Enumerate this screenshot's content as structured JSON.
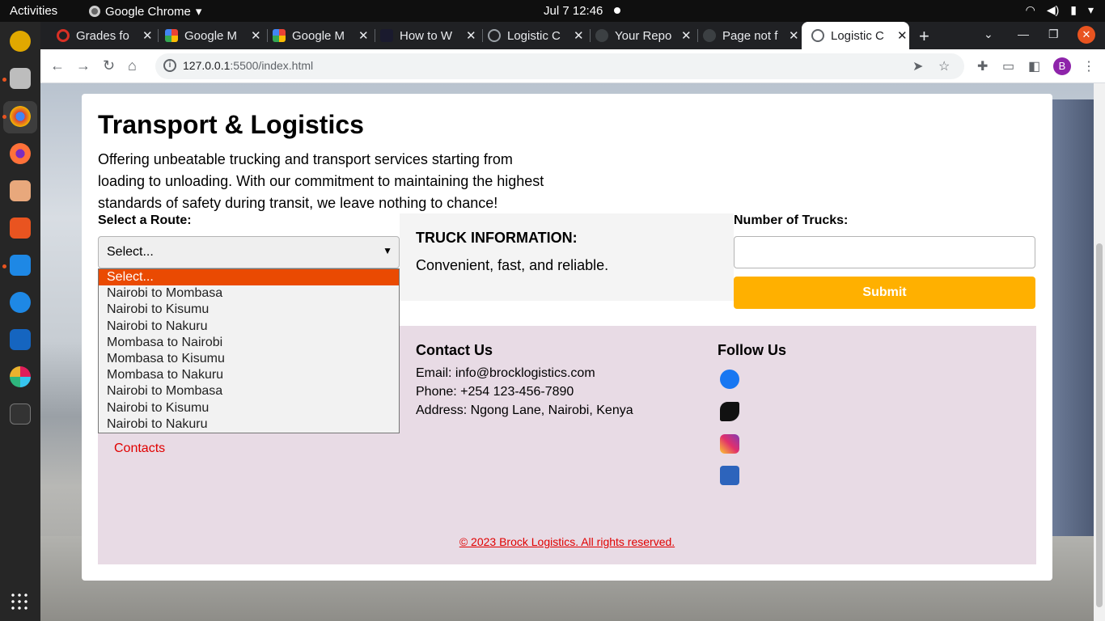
{
  "system": {
    "activities": "Activities",
    "app_name": "Google Chrome",
    "clock": "Jul 7  12:46"
  },
  "browser": {
    "tabs": [
      {
        "title": "Grades fo"
      },
      {
        "title": "Google M"
      },
      {
        "title": "Google M"
      },
      {
        "title": "How to W"
      },
      {
        "title": "Logistic C"
      },
      {
        "title": "Your Repo"
      },
      {
        "title": "Page not f"
      },
      {
        "title": "Logistic C"
      }
    ],
    "url_host": "127.0.0.1",
    "url_path": ":5500/index.html",
    "profile_initial": "B"
  },
  "page": {
    "title": "Transport & Logistics",
    "intro": "Offering unbeatable trucking and transport services starting from loading to unloading. With our commitment to maintaining the highest standards of safety during transit, we leave nothing to chance!",
    "route_label": "Select a Route:",
    "route_selected": "Select...",
    "route_options": [
      "Select...",
      "Nairobi to Mombasa",
      "Nairobi to Kisumu",
      "Nairobi to Nakuru",
      "Mombasa to Nairobi",
      "Mombasa to Kisumu",
      "Mombasa to Nakuru",
      "Nairobi to Mombasa",
      "Nairobi to Kisumu",
      "Nairobi to Nakuru"
    ],
    "truck_info_heading": "TRUCK INFORMATION:",
    "truck_info_text": "Convenient, fast, and reliable.",
    "trucks_label": "Number of Trucks:",
    "trucks_value": "",
    "submit_label": "Submit"
  },
  "footer": {
    "contacts_link": "Contacts",
    "contact_heading": "Contact Us",
    "email": "Email: info@brocklogistics.com",
    "phone": "Phone: +254 123-456-7890",
    "address": "Address: Ngong Lane, Nairobi, Kenya",
    "follow_heading": "Follow Us",
    "social": [
      "facebook-icon",
      "twitter-icon",
      "instagram-icon",
      "linkedin-icon"
    ],
    "copyright": "© 2023 Brock Logistics. All rights reserved."
  },
  "colors": {
    "accent_orange": "#ea4a02",
    "submit_yellow": "#ffb000",
    "footer_bg": "#e8dbe5",
    "link_red": "#e00000"
  }
}
